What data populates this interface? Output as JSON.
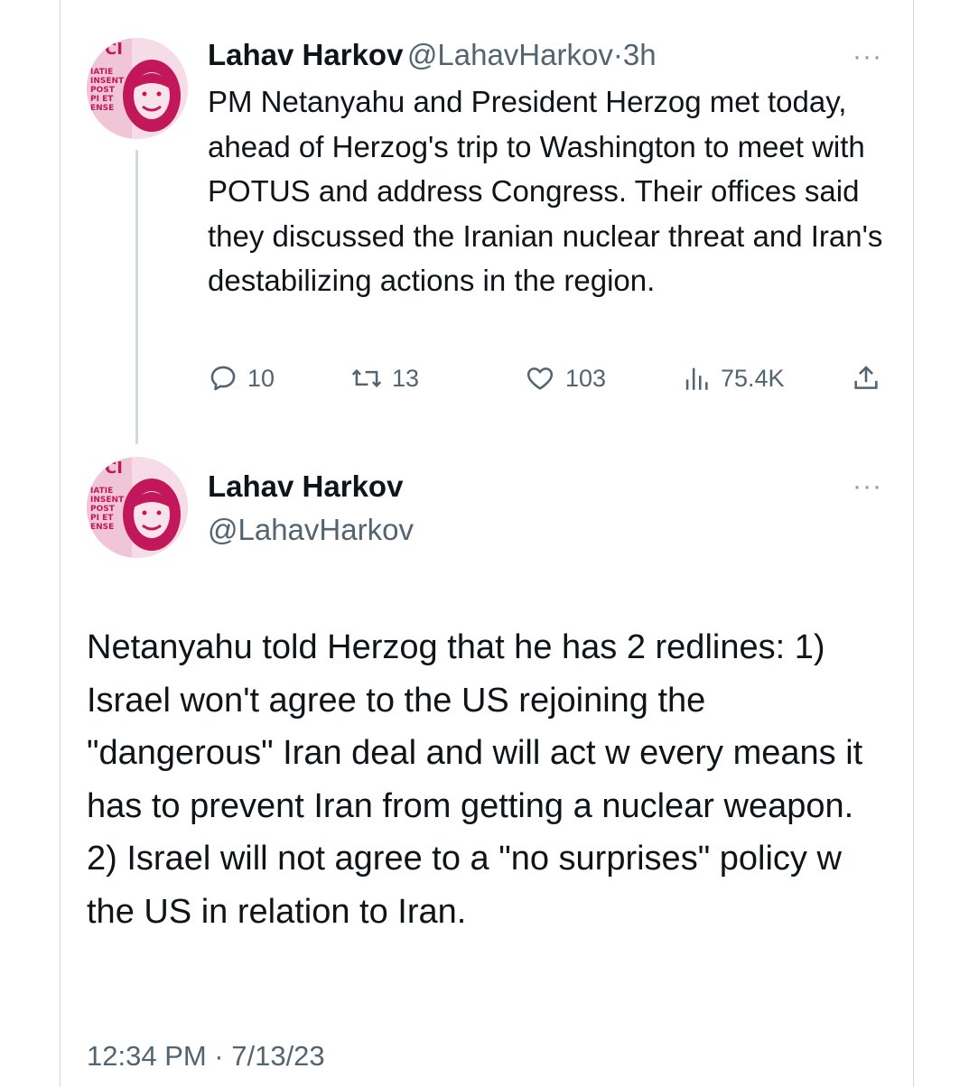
{
  "tweet1": {
    "author_name": "Lahav Harkov",
    "author_handle": "@LahavHarkov",
    "separator": "·",
    "time_ago": "3h",
    "more_label": "···",
    "text": "PM Netanyahu and President Herzog met today, ahead of Herzog's trip to Washington to meet with POTUS and address Congress. Their offices said they discussed the Iranian nuclear threat and Iran's destabilizing actions in the region.",
    "replies": "10",
    "retweets": "13",
    "likes": "103",
    "views": "75.4K"
  },
  "tweet2": {
    "author_name": "Lahav Harkov",
    "author_handle": "@LahavHarkov",
    "more_label": "···",
    "text": "Netanyahu told Herzog that he has 2 redlines: 1) Israel won't agree to the US rejoining the \"dangerous\" Iran deal and will act w every means it has to prevent Iran from getting a nuclear weapon. 2) Israel will not agree to a \"no surprises\" policy w the US in relation to Iran.",
    "timestamp": "12:34 PM · 7/13/23"
  },
  "icons": {
    "reply": "reply-icon",
    "retweet": "retweet-icon",
    "like": "heart-icon",
    "views": "views-chart-icon",
    "share": "share-icon"
  },
  "colors": {
    "secondary_text": "#536471",
    "border": "#cfd9de",
    "avatar_accent": "#c2185b"
  }
}
